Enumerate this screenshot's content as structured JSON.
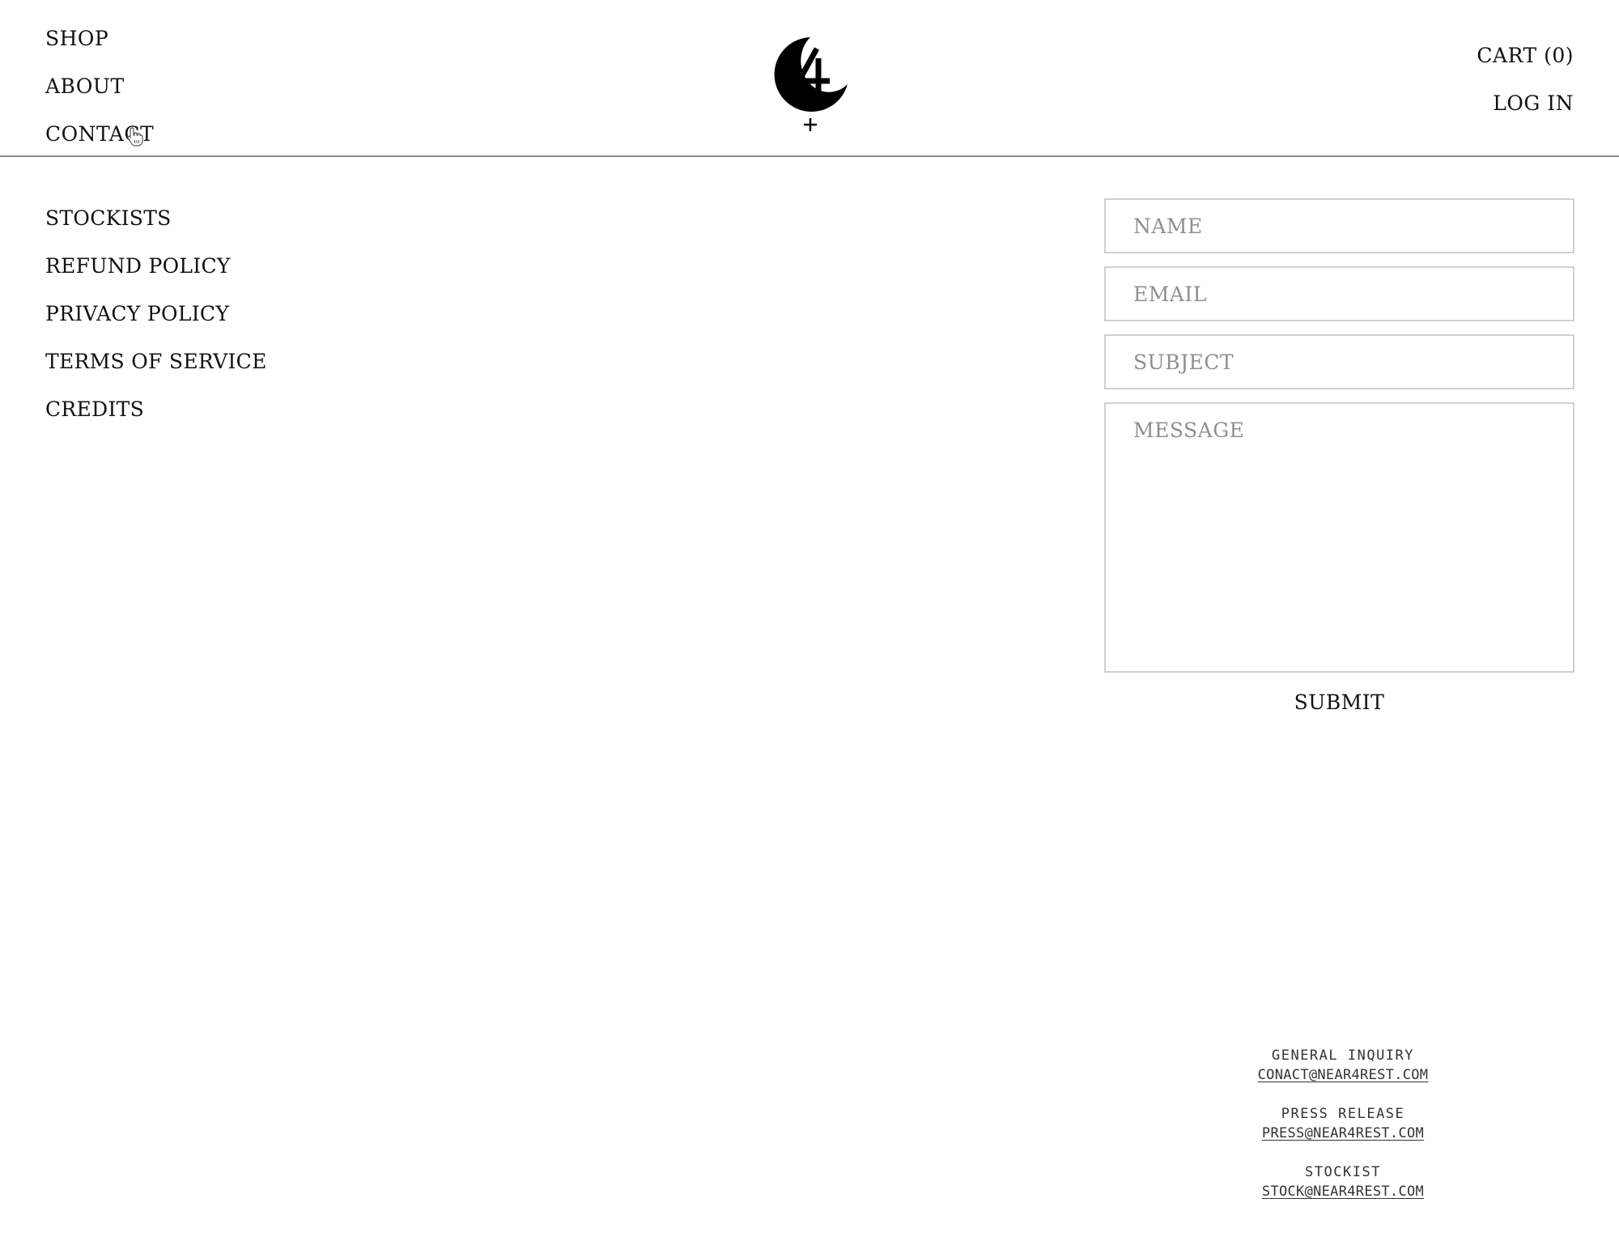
{
  "header": {
    "nav_left": [
      "SHOP",
      "ABOUT",
      "CONTACT"
    ],
    "cart_label": "CART (0)",
    "login_label": "LOG IN",
    "logo_icon": "crescent-4-plus-logo"
  },
  "side_menu": {
    "items": [
      "STOCKISTS",
      "REFUND POLICY",
      "PRIVACY POLICY",
      "TERMS OF SERVICE",
      "CREDITS"
    ]
  },
  "contact_form": {
    "name_placeholder": "NAME",
    "email_placeholder": "EMAIL",
    "subject_placeholder": "SUBJECT",
    "message_placeholder": "MESSAGE",
    "submit_label": "SUBMIT"
  },
  "contact_info": {
    "general_label": "GENERAL INQUIRY",
    "general_email": "CONACT@NEAR4REST.COM",
    "press_label": "PRESS RELEASE",
    "press_email": "PRESS@NEAR4REST.COM",
    "stockist_label": "STOCKIST",
    "stockist_email": "STOCK@NEAR4REST.COM"
  },
  "colors": {
    "divider": "#8c8c8c",
    "field_border": "#d0d0d0",
    "placeholder": "#8f8f8f",
    "text": "#111111"
  }
}
